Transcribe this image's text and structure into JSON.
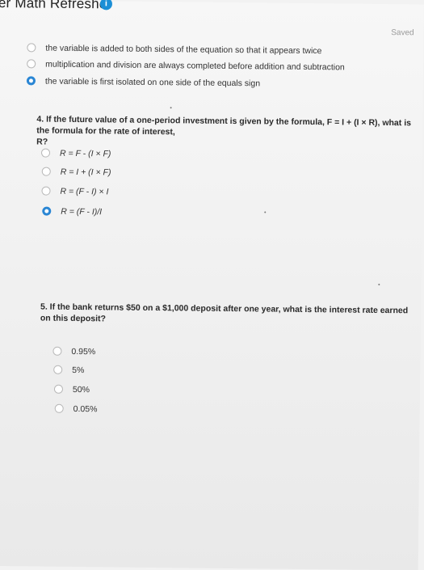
{
  "header": {
    "title": "er Math Refresher",
    "info_badge": "i",
    "status": "Saved"
  },
  "question3": {
    "options": [
      "the variable is added to both sides of the equation so that it appears twice",
      "multiplication and division are always completed before addition and subtraction",
      "the variable is first isolated on one side of the equals sign"
    ],
    "selected_index": 2
  },
  "question4": {
    "text_line1": "4. If the future value of a one-period investment is given by the formula, F = I + (I × R), what is the formula for the rate of interest,",
    "text_line2": "R?",
    "options": [
      "R = F - (I × F)",
      "R = I + (I × F)",
      "R = (F - I) × I",
      "R = (F - I)/I"
    ],
    "selected_index": 3
  },
  "question5": {
    "text": "5. If the bank returns $50 on a $1,000 deposit after one year, what is the interest rate earned on this deposit?",
    "options": [
      "0.95%",
      "5%",
      "50%",
      "0.05%"
    ],
    "selected_index": -1
  },
  "colors": {
    "selected_radio": "#2a86d4",
    "badge": "#1c8fd6"
  }
}
